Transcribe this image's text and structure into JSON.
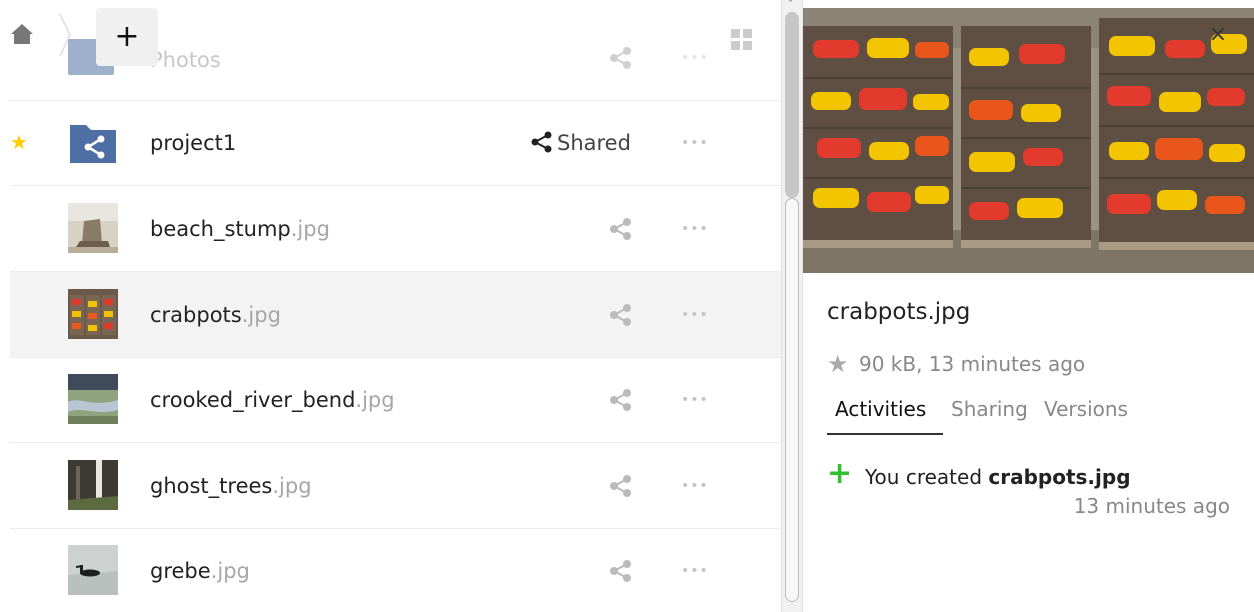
{
  "breadcrumb": {
    "home_icon": "home-icon",
    "new_label": "+"
  },
  "view_toggle_icon": "grid-view-icon",
  "files": [
    {
      "base": "Photos",
      "ext": "",
      "type": "folder",
      "favorite": false
    },
    {
      "base": "project1",
      "ext": "",
      "type": "shared-folder",
      "favorite": true,
      "share_label": "Shared"
    },
    {
      "base": "beach_stump",
      "ext": ".jpg",
      "type": "image",
      "favorite": false
    },
    {
      "base": "crabpots",
      "ext": ".jpg",
      "type": "image",
      "favorite": false,
      "selected": true
    },
    {
      "base": "crooked_river_bend",
      "ext": ".jpg",
      "type": "image",
      "favorite": false
    },
    {
      "base": "ghost_trees",
      "ext": ".jpg",
      "type": "image",
      "favorite": false
    },
    {
      "base": "grebe",
      "ext": ".jpg",
      "type": "image",
      "favorite": false
    }
  ],
  "more_label": "•••",
  "details": {
    "close_label": "×",
    "filename": "crabpots.jpg",
    "meta": "90 kB, 13 minutes ago",
    "tabs": [
      "Activities",
      "Sharing",
      "Versions"
    ],
    "active_tab": "Activities",
    "activity": {
      "prefix": "You created ",
      "target": "crabpots.jpg",
      "time": "13 minutes ago"
    }
  },
  "colors": {
    "favorite_star": "#ffcc00",
    "folder_blue": "#4d6fa3",
    "activity_green": "#2fbf2f",
    "extension_gray": "#a6a6a6"
  }
}
